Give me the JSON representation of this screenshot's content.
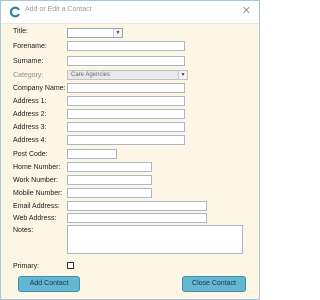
{
  "window": {
    "title": "Add or Edit a Contact",
    "close_glyph": "✕",
    "app_icon": "c-logo-icon",
    "accent": "#64b6d3"
  },
  "form": {
    "title_label": "Title:",
    "title_value": "",
    "forename_label": "Forename:",
    "surname_label": "Surname:",
    "category_label": "Category:",
    "category_value": "Care Agencies",
    "company_label": "Company Name:",
    "address1_label": "Address 1:",
    "address2_label": "Address 2:",
    "address3_label": "Address 3:",
    "address4_label": "Address 4:",
    "postcode_label": "Post Code:",
    "home_label": "Home Number:",
    "work_label": "Work Number:",
    "mobile_label": "Mobile Number:",
    "email_label": "Email Address:",
    "web_label": "Web Address:",
    "notes_label": "Notes:",
    "primary_label": "Primary:",
    "primary_checked": false
  },
  "buttons": {
    "add": "Add Contact",
    "close": "Close Contact"
  }
}
